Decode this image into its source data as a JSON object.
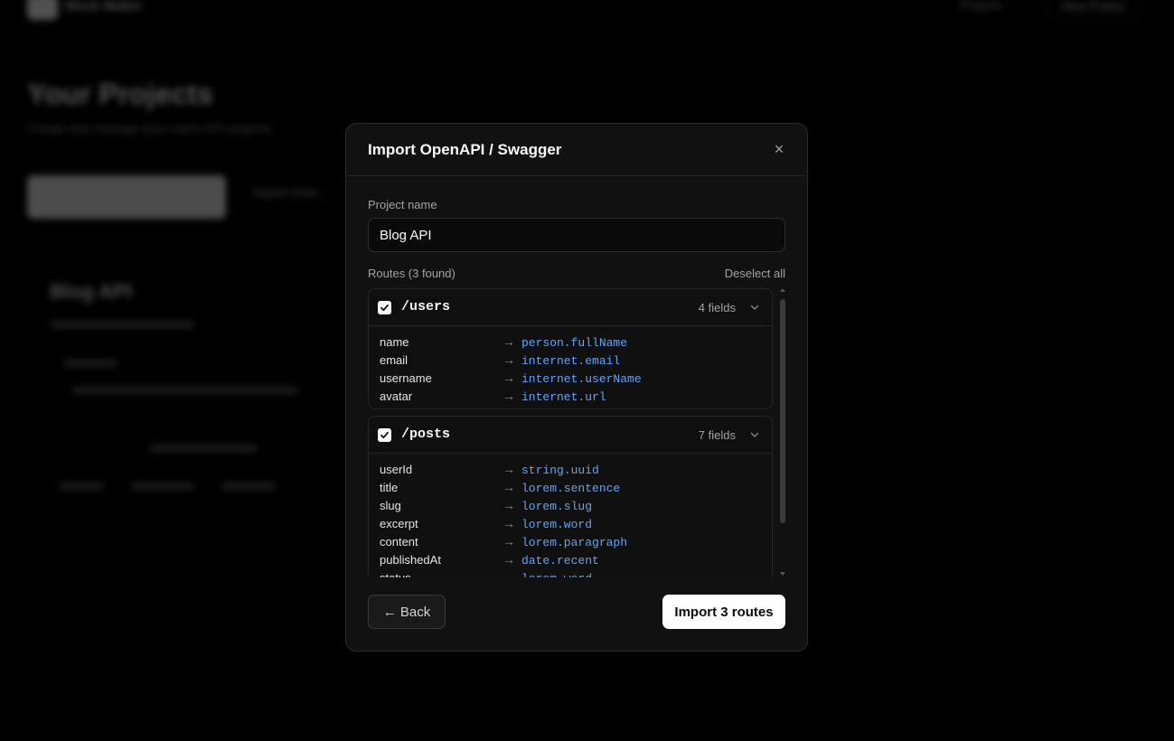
{
  "background": {
    "brand": "Mock Maker",
    "nav_link": "Projects",
    "nav_button": "New Project",
    "title": "Your Projects",
    "subtitle": "Create and manage your mock API projects",
    "secondary_action": "Import from...",
    "card_title": "Blog API"
  },
  "modal": {
    "title": "Import OpenAPI / Swagger",
    "close_icon": "×",
    "project_name_label": "Project name",
    "project_name_value": "Blog API",
    "routes_label": "Routes (3 found)",
    "deselect_all": "Deselect all",
    "routes": [
      {
        "path": "/users",
        "field_count": "4 fields",
        "checked": true,
        "fields": [
          {
            "name": "name",
            "arrow": "→",
            "type": "person.fullName"
          },
          {
            "name": "email",
            "arrow": "→",
            "type": "internet.email"
          },
          {
            "name": "username",
            "arrow": "→",
            "type": "internet.userName"
          },
          {
            "name": "avatar",
            "arrow": "→",
            "type": "internet.url"
          }
        ]
      },
      {
        "path": "/posts",
        "field_count": "7 fields",
        "checked": true,
        "fields": [
          {
            "name": "userId",
            "arrow": "→",
            "type": "string.uuid"
          },
          {
            "name": "title",
            "arrow": "→",
            "type": "lorem.sentence"
          },
          {
            "name": "slug",
            "arrow": "→",
            "type": "lorem.slug"
          },
          {
            "name": "excerpt",
            "arrow": "→",
            "type": "lorem.word"
          },
          {
            "name": "content",
            "arrow": "→",
            "type": "lorem.paragraph"
          },
          {
            "name": "publishedAt",
            "arrow": "→",
            "type": "date.recent"
          },
          {
            "name": "status",
            "arrow": "→",
            "type": "lorem.word"
          }
        ]
      }
    ],
    "back_button": "← Back",
    "import_button": "Import 3 routes"
  },
  "colors": {
    "accent_blue": "#60a5fa",
    "modal_bg": "#111111",
    "primary_button": "#ffffff"
  }
}
